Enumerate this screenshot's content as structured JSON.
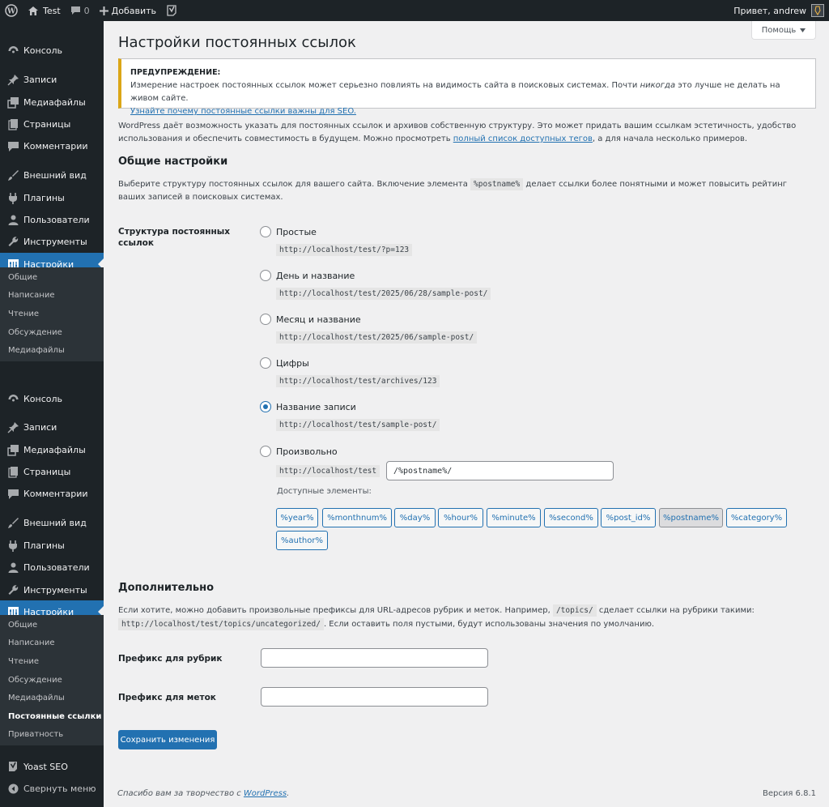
{
  "adminbar": {
    "site_name": "Test",
    "comments_count": "0",
    "add_label": "Добавить",
    "greeting": "Привет, andrew"
  },
  "sidebar": {
    "menus": [
      {
        "items": [
          {
            "label": "Консоль",
            "icon": "dashboard-icon"
          },
          {
            "label": "Записи",
            "icon": "pin-icon"
          },
          {
            "label": "Медиафайлы",
            "icon": "media-icon"
          },
          {
            "label": "Страницы",
            "icon": "pages-icon"
          },
          {
            "label": "Комментарии",
            "icon": "comments-icon"
          },
          {
            "label": "Внешний вид",
            "icon": "brush-icon"
          },
          {
            "label": "Плагины",
            "icon": "plugin-icon"
          },
          {
            "label": "Пользователи",
            "icon": "users-icon"
          },
          {
            "label": "Инструменты",
            "icon": "wrench-icon"
          },
          {
            "label": "Настройки",
            "icon": "settings-icon"
          }
        ],
        "submenu": [
          "Общие",
          "Написание",
          "Чтение",
          "Обсуждение",
          "Медиафайлы"
        ]
      },
      {
        "items": [
          {
            "label": "Консоль",
            "icon": "dashboard-icon"
          },
          {
            "label": "Записи",
            "icon": "pin-icon"
          },
          {
            "label": "Медиафайлы",
            "icon": "media-icon"
          },
          {
            "label": "Страницы",
            "icon": "pages-icon"
          },
          {
            "label": "Комментарии",
            "icon": "comments-icon"
          },
          {
            "label": "Внешний вид",
            "icon": "brush-icon"
          },
          {
            "label": "Плагины",
            "icon": "plugin-icon"
          },
          {
            "label": "Пользователи",
            "icon": "users-icon"
          },
          {
            "label": "Инструменты",
            "icon": "wrench-icon"
          },
          {
            "label": "Настройки",
            "icon": "settings-icon"
          }
        ],
        "submenu": [
          "Общие",
          "Написание",
          "Чтение",
          "Обсуждение",
          "Медиафайлы",
          "Постоянные ссылки",
          "Приватность"
        ]
      }
    ],
    "yoast": "Yoast SEO",
    "collapse": "Свернуть меню"
  },
  "help_button": "Помощь",
  "page_title": "Настройки постоянных ссылок",
  "notice": {
    "title": "ПРЕДУПРЕЖДЕНИЕ:",
    "text_before": "Измерение настроек постоянных ссылок может серьезно повлиять на видимость сайта в поисковых системах. Почти ",
    "text_italic": "никогда",
    "text_after": " это лучше не делать на живом сайте.",
    "link": "Узнайте почему постоянные ссылки важны для SEO."
  },
  "intro": {
    "text_before": "WordPress даёт возможность указать для постоянных ссылок и архивов собственную структуру. Это может придать вашим ссылкам эстетичность, удобство использования и обеспечить совместимость в будущем. Можно просмотреть ",
    "link": "полный список доступных тегов",
    "text_after": ", а для начала несколько примеров."
  },
  "common": {
    "heading": "Общие настройки",
    "desc_before": "Выберите структуру постоянных ссылок для вашего сайта. Включение элемента ",
    "desc_code": "%postname%",
    "desc_after": " делает ссылки более понятными и может повысить рейтинг ваших записей в поисковых системах.",
    "field_label": "Структура постоянных ссылок",
    "options": [
      {
        "label": "Простые",
        "sample": "http://localhost/test/?p=123",
        "checked": false
      },
      {
        "label": "День и название",
        "sample": "http://localhost/test/2025/06/28/sample-post/",
        "checked": false
      },
      {
        "label": "Месяц и название",
        "sample": "http://localhost/test/2025/06/sample-post/",
        "checked": false
      },
      {
        "label": "Цифры",
        "sample": "http://localhost/test/archives/123",
        "checked": false
      },
      {
        "label": "Название записи",
        "sample": "http://localhost/test/sample-post/",
        "checked": true
      },
      {
        "label": "Произвольно",
        "sample": "http://localhost/test",
        "checked": false
      }
    ],
    "custom_value": "/%postname%/",
    "available_label": "Доступные элементы:",
    "tags": [
      "%year%",
      "%monthnum%",
      "%day%",
      "%hour%",
      "%minute%",
      "%second%",
      "%post_id%",
      "%postname%",
      "%category%",
      "%author%"
    ],
    "pressed_tag": "%postname%"
  },
  "optional": {
    "heading": "Дополнительно",
    "desc_before": "Если хотите, можно добавить произвольные префиксы для URL-адресов рубрик и меток. Например, ",
    "desc_code1": "/topics/",
    "desc_mid": " сделает ссылки на рубрики такими:",
    "desc_code2": "http://localhost/test/topics/uncategorized/",
    "desc_after": ". Если оставить поля пустыми, будут использованы значения по умолчанию.",
    "category_label": "Префикс для рубрик",
    "tag_label": "Префикс для меток",
    "category_value": "",
    "tag_value": ""
  },
  "save_button": "Сохранить изменения",
  "footer": {
    "thanks_before": "Спасибо вам за творчество с ",
    "thanks_link": "WordPress",
    "thanks_after": ".",
    "version": "Версия 6.8.1"
  }
}
